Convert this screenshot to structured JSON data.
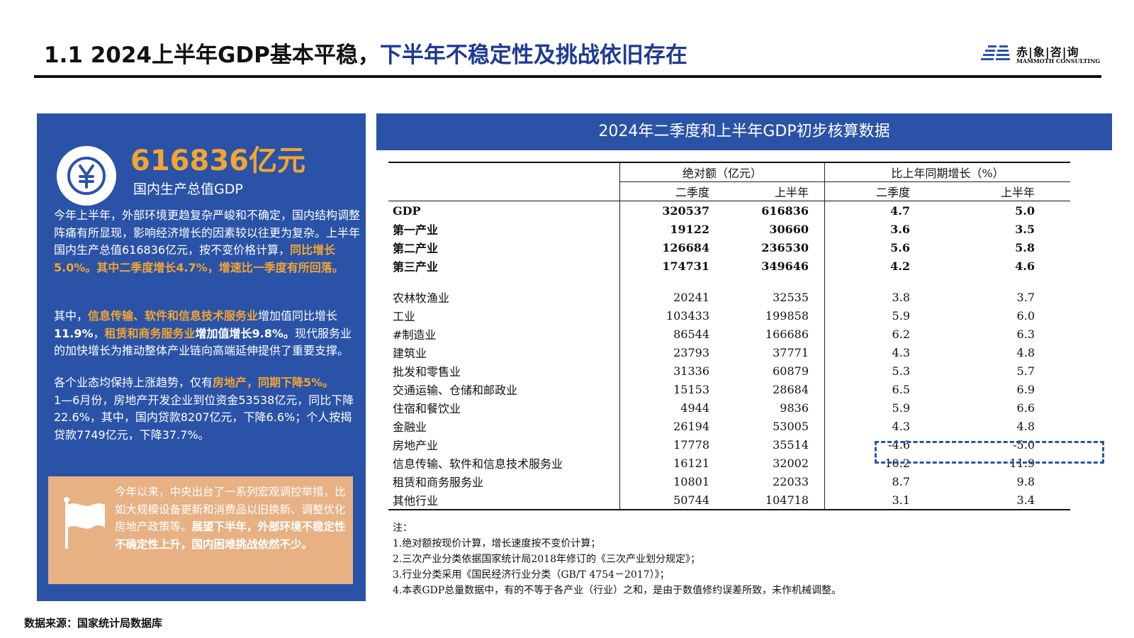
{
  "header": {
    "title_part1": "1.1 2024上半年GDP基本平稳，",
    "title_part2": "下半年不稳定性及挑战依旧存在",
    "logo_cn": "赤|象|咨|询",
    "logo_en": "MAMMOTH CONSULTING"
  },
  "left": {
    "big_number": "616836亿元",
    "big_label": "国内生产总值GDP",
    "p1_a": "今年上半年，外部环境更趋复杂严峻和不确定，国内结构调整阵痛有所显现，影响经济增长的因素较以往更为复杂。上半年国内生产总值616836亿元，按不变价格计算，",
    "p1_hl": "同比增长5.0%。其中二季度增长4.7%，增速比一季度有所回落。",
    "p2_a": "其中，",
    "p2_hl1": "信息传输、软件和信息技术服务业",
    "p2_b": "增加值同比增长",
    "p2_bold1": "11.9%",
    "p2_c": "，",
    "p2_hl2": "租赁和商务服务业",
    "p2_bold2": "增加值增长9.8%。",
    "p2_d": "现代服务业的加快增长为推动整体产业链向高端延伸提供了重要支撑。",
    "p3_a": "各个业态均保持上涨趋势，仅有",
    "p3_hl": "房地产，同期下降5%。",
    "p3_b": "1—6月份，房地产开发企业到位资金53538亿元，同比下降22.6%，其中，国内贷款8207亿元，下降6.6%；个人按揭贷款7749亿元，下降37.7%。",
    "note_a": "今年以来，中央出台了一系列宏观调控举措，比如大规模设备更新和消费品以旧换新、调整优化房地产政策等。",
    "note_b": "展望下半年，外部环境不稳定性不确定性上升，国内困难挑战依然不少。"
  },
  "table": {
    "title": "2024年二季度和上半年GDP初步核算数据",
    "group1": "绝对额（亿元）",
    "group2": "比上年同期增长（%）",
    "sub": [
      "二季度",
      "上半年",
      "二季度",
      "上半年"
    ],
    "rows_main": [
      {
        "name": "GDP",
        "a1": "320537",
        "a2": "616836",
        "g1": "4.7",
        "g2": "5.0"
      },
      {
        "name": "第一产业",
        "a1": "19122",
        "a2": "30660",
        "g1": "3.6",
        "g2": "3.5"
      },
      {
        "name": "第二产业",
        "a1": "126684",
        "a2": "236530",
        "g1": "5.6",
        "g2": "5.8"
      },
      {
        "name": "第三产业",
        "a1": "174731",
        "a2": "349646",
        "g1": "4.2",
        "g2": "4.6"
      }
    ],
    "rows_ind": [
      {
        "name": "农林牧渔业",
        "a1": "20241",
        "a2": "32535",
        "g1": "3.8",
        "g2": "3.7"
      },
      {
        "name": "工业",
        "a1": "103433",
        "a2": "199858",
        "g1": "5.9",
        "g2": "6.0"
      },
      {
        "name": "#制造业",
        "a1": "86544",
        "a2": "166686",
        "g1": "6.2",
        "g2": "6.3"
      },
      {
        "name": "建筑业",
        "a1": "23793",
        "a2": "37771",
        "g1": "4.3",
        "g2": "4.8"
      },
      {
        "name": "批发和零售业",
        "a1": "31336",
        "a2": "60879",
        "g1": "5.3",
        "g2": "5.7"
      },
      {
        "name": "交通运输、仓储和邮政业",
        "a1": "15153",
        "a2": "28684",
        "g1": "6.5",
        "g2": "6.9"
      },
      {
        "name": "住宿和餐饮业",
        "a1": "4944",
        "a2": "9836",
        "g1": "5.9",
        "g2": "6.6"
      },
      {
        "name": "金融业",
        "a1": "26194",
        "a2": "53005",
        "g1": "4.3",
        "g2": "4.8"
      },
      {
        "name": "房地产业",
        "a1": "17778",
        "a2": "35514",
        "g1": "-4.6",
        "g2": "-5.0"
      },
      {
        "name": "信息传输、软件和信息技术服务业",
        "a1": "16121",
        "a2": "32002",
        "g1": "10.2",
        "g2": "11.9"
      },
      {
        "name": "租赁和商务服务业",
        "a1": "10801",
        "a2": "22033",
        "g1": "8.7",
        "g2": "9.8"
      },
      {
        "name": "其他行业",
        "a1": "50744",
        "a2": "104718",
        "g1": "3.1",
        "g2": "3.4"
      }
    ],
    "notes": [
      "注：",
      "1.绝对额按现价计算，增长速度按不变价计算；",
      "2.三次产业分类依据国家统计局2018年修订的《三次产业划分规定》；",
      "3.行业分类采用《国民经济行业分类（GB/T 4754－2017）》；",
      "4.本表GDP总量数据中，有的不等于各产业（行业）之和，是由于数值修约误差所致，未作机械调整。"
    ]
  },
  "footer": {
    "source": "数据来源：国家统计局数据库"
  },
  "colors": {
    "blue": "#2a53a8",
    "orange": "#f3a530",
    "note_bg": "#e7b184"
  }
}
